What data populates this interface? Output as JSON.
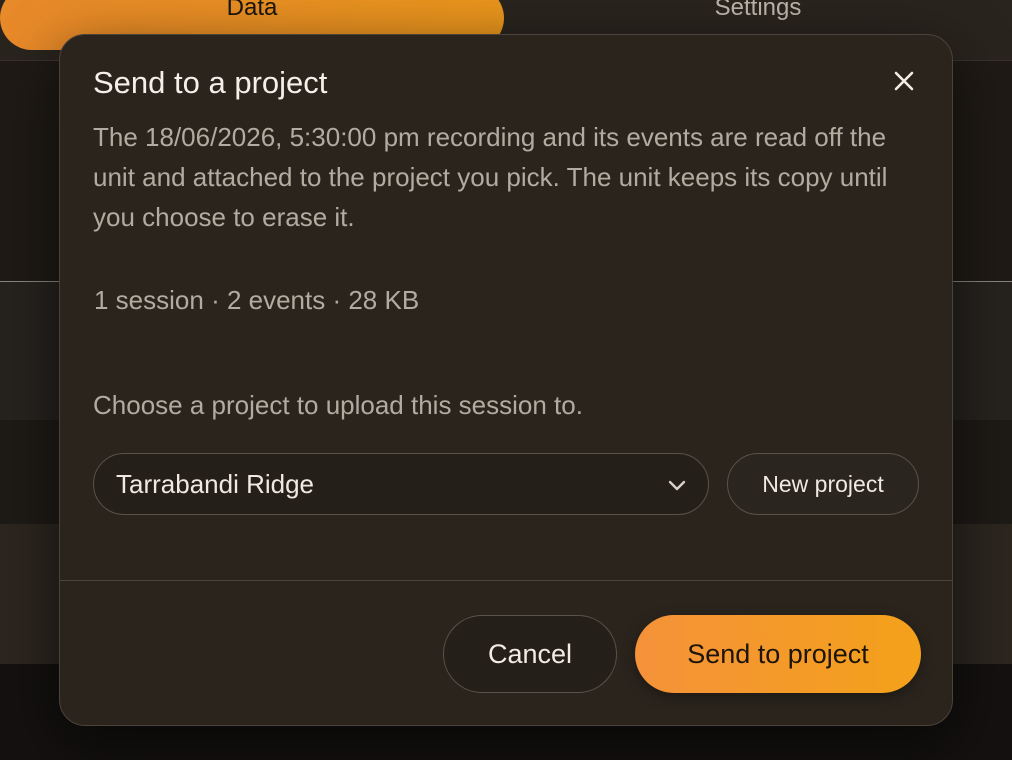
{
  "tabs": [
    {
      "label": "Data",
      "active": true
    },
    {
      "label": "Settings",
      "active": false
    }
  ],
  "modal": {
    "title": "Send to a project",
    "description": "The 18/06/2026, 5:30:00 pm recording and its events are read off the unit and attached to the project you pick. The unit keeps its copy until you choose to erase it.",
    "summary": "1 session · 2 events · 28 KB",
    "prompt": "Choose a project to upload this session to.",
    "project_select": {
      "value": "Tarrabandi Ridge",
      "icon": "chevron-down-icon"
    },
    "new_project_label": "New project",
    "cancel_label": "Cancel",
    "submit_label": "Send to project",
    "close_icon": "close-icon"
  },
  "colors": {
    "accent": "#f4992a",
    "modal_bg": "#2a241d",
    "text_primary": "#f4efe8",
    "text_secondary": "#b3aba0"
  }
}
